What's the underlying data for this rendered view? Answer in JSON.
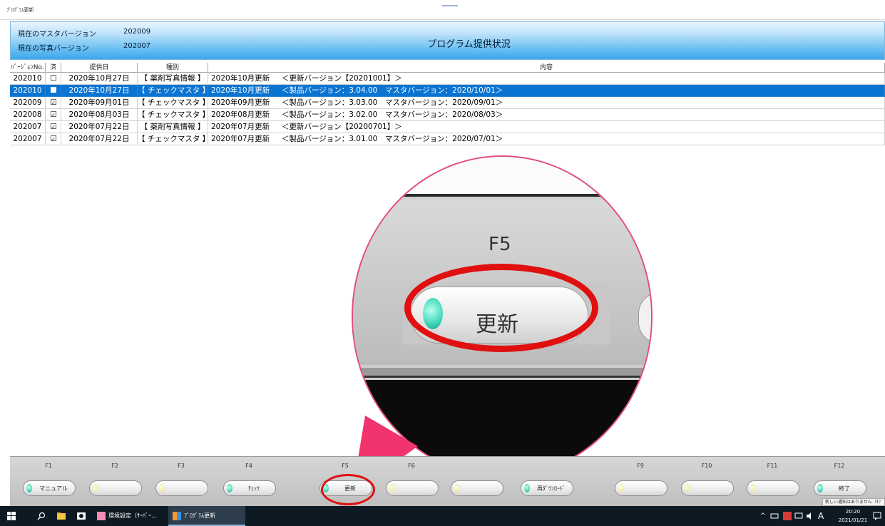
{
  "window": {
    "title": "ﾌﾟﾛｸﾞﾗﾑ更新"
  },
  "header": {
    "master_label": "現在のマスタバージョン",
    "master_value": "202009",
    "photo_label": "現在の写真バージョン",
    "photo_value": "202007",
    "title": "プログラム提供状況"
  },
  "table": {
    "columns": [
      "ﾊﾞｰｼﾞｮﾝNo.",
      "済",
      "提供日",
      "種別",
      "内容"
    ],
    "rows": [
      {
        "version": "202010",
        "done": "unchecked",
        "date": "2020年10月27日",
        "kind": "【 薬剤写真情報 】",
        "update": "2020年10月更新",
        "content": "＜更新バージョン【20201001】＞"
      },
      {
        "version": "202010",
        "done": "filled",
        "date": "2020年10月27日",
        "kind": "【 チェックマスタ 】",
        "update": "2020年10月更新",
        "content": "＜製品バージョン：3.04.00　マスタバージョン：2020/10/01＞"
      },
      {
        "version": "202009",
        "done": "checked",
        "date": "2020年09月01日",
        "kind": "【 チェックマスタ 】",
        "update": "2020年09月更新",
        "content": "＜製品バージョン：3.03.00　マスタバージョン：2020/09/01＞"
      },
      {
        "version": "202008",
        "done": "checked",
        "date": "2020年08月03日",
        "kind": "【 チェックマスタ 】",
        "update": "2020年08月更新",
        "content": "＜製品バージョン：3.02.00　マスタバージョン：2020/08/03＞"
      },
      {
        "version": "202007",
        "done": "checked",
        "date": "2020年07月22日",
        "kind": "【 薬剤写真情報 】",
        "update": "2020年07月更新",
        "content": "＜更新バージョン【20200701】＞"
      },
      {
        "version": "202007",
        "done": "checked",
        "date": "2020年07月22日",
        "kind": "【 チェックマスタ 】",
        "update": "2020年07月更新",
        "content": "＜製品バージョン：3.01.00　マスタバージョン：2020/07/01＞"
      }
    ],
    "selected_index": 1
  },
  "zoom": {
    "key": "F5",
    "label": "更新"
  },
  "fkeys": [
    {
      "key": "F1",
      "label": "マニュアル",
      "led": "on"
    },
    {
      "key": "F2",
      "label": "",
      "led": "off"
    },
    {
      "key": "F3",
      "label": "",
      "led": "off"
    },
    {
      "key": "F4",
      "label": "ﾁｪｯｸ",
      "led": "on"
    },
    {
      "key": "F5",
      "label": "更新",
      "led": "on"
    },
    {
      "key": "F6",
      "label": "",
      "led": "off"
    },
    {
      "key": "",
      "label": "",
      "led": "off"
    },
    {
      "key": "",
      "label": "再ﾀﾞｳﾝﾛｰﾄﾞ",
      "led": "on"
    },
    {
      "key": "F9",
      "label": "",
      "led": "off"
    },
    {
      "key": "F10",
      "label": "",
      "led": "off"
    },
    {
      "key": "F11",
      "label": "",
      "led": "off"
    },
    {
      "key": "F12",
      "label": "終了",
      "led": "on"
    }
  ],
  "taskbar": {
    "app1": "環境設定（ｻｰﾊﾞｰ...",
    "app2": "ﾌﾟﾛｸﾞﾗﾑ更新",
    "ime": "A",
    "time": "20:20",
    "date": "2021/01/21",
    "tooltip": "新しい通知はありません（ｵﾌ"
  },
  "colors": {
    "selection": "#0a74d2",
    "highlight_ring": "#e01010",
    "magnifier_border": "#e24d77"
  }
}
